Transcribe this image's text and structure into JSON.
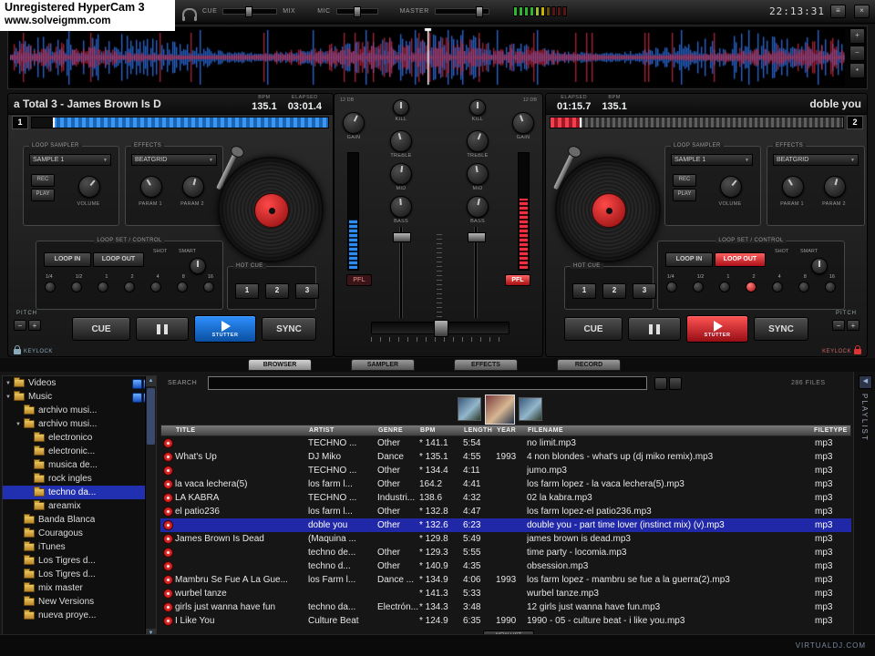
{
  "watermark": {
    "line1": "Unregistered HyperCam 3",
    "line2": "www.solveigmm.com"
  },
  "topbar": {
    "cue_label": "CUE",
    "mix_label": "MIX",
    "mic_label": "MIC",
    "master_label": "MASTER",
    "clock": "22:13:31",
    "buttons": [
      "≡",
      "×"
    ]
  },
  "rhythm": {
    "tools": [
      "+",
      "−",
      "•"
    ]
  },
  "decks": {
    "left": {
      "number": "1",
      "title": "a Total 3 - James Brown Is D",
      "bpm_label": "BPM",
      "bpm": "135.1",
      "elapsed_label": "ELAPSED",
      "elapsed": "03:01.4"
    },
    "right": {
      "number": "2",
      "title": "doble you",
      "bpm_label": "BPM",
      "bpm": "135.1",
      "elapsed_label": "ELAPSED",
      "elapsed": "01:15.7"
    }
  },
  "deck_controls": {
    "loop_sampler_label": "LOOP SAMPLER",
    "sampler_dropdown": "SAMPLE 1",
    "rec_label": "REC",
    "play_label": "PLAY",
    "volume_label": "VOLUME",
    "effects_label": "EFFECTS",
    "effect_dropdown": "BEATGRID",
    "param1_label": "PARAM 1",
    "param2_label": "PARAM 2",
    "loop_set_label": "LOOP SET / CONTROL",
    "loop_in": "LOOP IN",
    "loop_out": "LOOP OUT",
    "shot_label": "SHOT",
    "smart_label": "SMART",
    "beats": [
      "1/4",
      "1/2",
      "1",
      "2",
      "4",
      "8",
      "16"
    ],
    "hot_cue_label": "HOT CUE",
    "cue_buttons": [
      "1",
      "2",
      "3"
    ],
    "cue_label": "CUE",
    "stutter_label": "STUTTER",
    "sync_label": "SYNC",
    "pitch_label": "PITCH",
    "keylock_label": "KEYLOCK"
  },
  "mixer": {
    "db_label": "12 DB",
    "kill_label": "KILL",
    "gain_label": "GAIN",
    "treble_label": "TREBLE",
    "mid_label": "MID",
    "bass_label": "BASS",
    "pfl_label": "PFL"
  },
  "tabs": {
    "items": [
      {
        "label": "BROWSER",
        "active": true
      },
      {
        "label": "SAMPLER",
        "active": false
      },
      {
        "label": "EFFECTS",
        "active": false
      },
      {
        "label": "RECORD",
        "active": false
      }
    ]
  },
  "browser": {
    "search_label": "SEARCH",
    "search_value": "",
    "files_count": "286 FILES",
    "playlist_label": "PLAYLIST",
    "new_list_label": "NEW LIST",
    "credit": "VIRTUALDJ.COM",
    "folders": [
      {
        "label": "Videos",
        "indent": 0,
        "expanded": true,
        "selected": false
      },
      {
        "label": "Music",
        "indent": 0,
        "expanded": true,
        "selected": false
      },
      {
        "label": "archivo musi...",
        "indent": 1,
        "expanded": false,
        "selected": false
      },
      {
        "label": "archivo musi...",
        "indent": 1,
        "expanded": true,
        "selected": false
      },
      {
        "label": "electronico",
        "indent": 2,
        "selected": false
      },
      {
        "label": "electronic...",
        "indent": 2,
        "selected": false
      },
      {
        "label": "musica de...",
        "indent": 2,
        "selected": false
      },
      {
        "label": "rock ingles",
        "indent": 2,
        "selected": false
      },
      {
        "label": "techno da...",
        "indent": 2,
        "selected": true
      },
      {
        "label": "areamix",
        "indent": 2,
        "selected": false
      },
      {
        "label": "Banda Blanca",
        "indent": 1,
        "selected": false
      },
      {
        "label": "Couragous",
        "indent": 1,
        "selected": false
      },
      {
        "label": "iTunes",
        "indent": 1,
        "selected": false
      },
      {
        "label": "Los Tigres d...",
        "indent": 1,
        "selected": false
      },
      {
        "label": "Los Tigres d...",
        "indent": 1,
        "selected": false
      },
      {
        "label": "mix master",
        "indent": 1,
        "selected": false
      },
      {
        "label": "New Versions",
        "indent": 1,
        "selected": false
      },
      {
        "label": "nueva proye...",
        "indent": 1,
        "selected": false
      }
    ],
    "table": {
      "headers": [
        "TITLE",
        "ARTIST",
        "GENRE",
        "BPM",
        "LENGTH",
        "YEAR",
        "FILENAME",
        "FILETYPE"
      ],
      "rows": [
        {
          "title": "",
          "artist": "TECHNO ...",
          "genre": "Other",
          "bpm": "* 141.1",
          "length": "5:54",
          "year": "",
          "filename": "no limit.mp3",
          "type": "mp3",
          "selected": false
        },
        {
          "title": "What's Up",
          "artist": "DJ Miko",
          "genre": "Dance",
          "bpm": "* 135.1",
          "length": "4:55",
          "year": "1993",
          "filename": "4 non blondes - what's up (dj miko remix).mp3",
          "type": "mp3",
          "selected": false
        },
        {
          "title": "",
          "artist": "TECHNO ...",
          "genre": "Other",
          "bpm": "* 134.4",
          "length": "4:11",
          "year": "",
          "filename": "jumo.mp3",
          "type": "mp3",
          "selected": false
        },
        {
          "title": "la vaca lechera(5)",
          "artist": "los farm l...",
          "genre": "Other",
          "bpm": "164.2",
          "length": "4:41",
          "year": "",
          "filename": "los farm lopez - la vaca lechera(5).mp3",
          "type": "mp3",
          "selected": false
        },
        {
          "title": "LA KABRA",
          "artist": "TECHNO ...",
          "genre": "Industri...",
          "bpm": "138.6",
          "length": "4:32",
          "year": "",
          "filename": "02 la kabra.mp3",
          "type": "mp3",
          "selected": false
        },
        {
          "title": "el patio236",
          "artist": "los farm l...",
          "genre": "Other",
          "bpm": "* 132.8",
          "length": "4:47",
          "year": "",
          "filename": "los farm lopez-el patio236.mp3",
          "type": "mp3",
          "selected": false
        },
        {
          "title": "",
          "artist": "doble you",
          "genre": "Other",
          "bpm": "* 132.6",
          "length": "6:23",
          "year": "",
          "filename": "double you - part time lover (instinct mix) (v).mp3",
          "type": "mp3",
          "selected": true
        },
        {
          "title": "James Brown Is Dead",
          "artist": "(Maquina ...",
          "genre": "",
          "bpm": "* 129.8",
          "length": "5:49",
          "year": "",
          "filename": "james brown is dead.mp3",
          "type": "mp3",
          "selected": false
        },
        {
          "title": "",
          "artist": "techno de...",
          "genre": "Other",
          "bpm": "* 129.3",
          "length": "5:55",
          "year": "",
          "filename": "time party - locomia.mp3",
          "type": "mp3",
          "selected": false
        },
        {
          "title": "",
          "artist": "techno d...",
          "genre": "Other",
          "bpm": "* 140.9",
          "length": "4:35",
          "year": "",
          "filename": "obsession.mp3",
          "type": "mp3",
          "selected": false
        },
        {
          "title": "Mambru Se Fue A La Gue...",
          "artist": "los Farm l...",
          "genre": "Dance ...",
          "bpm": "* 134.9",
          "length": "4:06",
          "year": "1993",
          "filename": "los farm lopez - mambru se fue a la guerra(2).mp3",
          "type": "mp3",
          "selected": false
        },
        {
          "title": "wurbel tanze",
          "artist": "",
          "genre": "",
          "bpm": "* 141.3",
          "length": "5:33",
          "year": "",
          "filename": "wurbel tanze.mp3",
          "type": "mp3",
          "selected": false
        },
        {
          "title": "girls just wanna have fun",
          "artist": "techno da...",
          "genre": "Electrón...",
          "bpm": "* 134.3",
          "length": "3:48",
          "year": "",
          "filename": "12 girls just wanna have fun.mp3",
          "type": "mp3",
          "selected": false
        },
        {
          "title": "I Like You",
          "artist": "Culture Beat",
          "genre": "",
          "bpm": "* 124.9",
          "length": "6:35",
          "year": "1990",
          "filename": "1990 - 05 - culture beat - i like you.mp3",
          "type": "mp3",
          "selected": false
        }
      ]
    }
  }
}
